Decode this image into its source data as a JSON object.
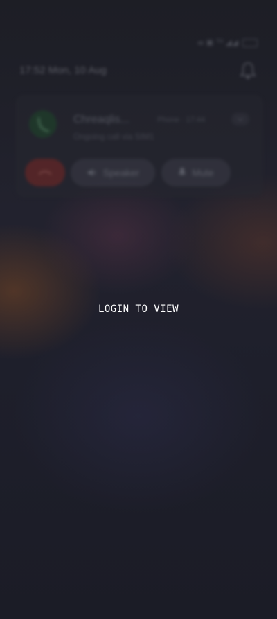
{
  "status_bar": {
    "indicators": "๗ ▣ ᵀᴴ ◢◢",
    "battery_icon": "battery-icon"
  },
  "lockscreen": {
    "datetime": "17:52 Mon, 10 Aug",
    "bell_icon": "bell-icon"
  },
  "call_notification": {
    "caller_name": "Chreaqlis...",
    "app_time": "Phone · 17:44",
    "subtitle": "Ongoing call via SIM1",
    "end_icon": "end-call-icon",
    "speaker_label": "Speaker",
    "mute_label": "Mute"
  },
  "overlay": {
    "message": "LOGIN TO VIEW"
  }
}
